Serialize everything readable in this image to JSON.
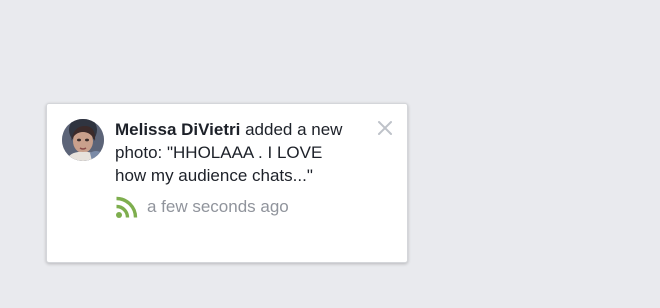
{
  "notification": {
    "actor_name": "Melissa DiVietri",
    "message_text": " added a new photo: \"HHOLAAA . I LOVE how my audience chats...\"",
    "timestamp": "a few seconds ago",
    "avatar_icon": "profile-photo",
    "type_icon": "feed-icon",
    "type_icon_color": "#7eae4e",
    "close_icon": "close-icon"
  }
}
